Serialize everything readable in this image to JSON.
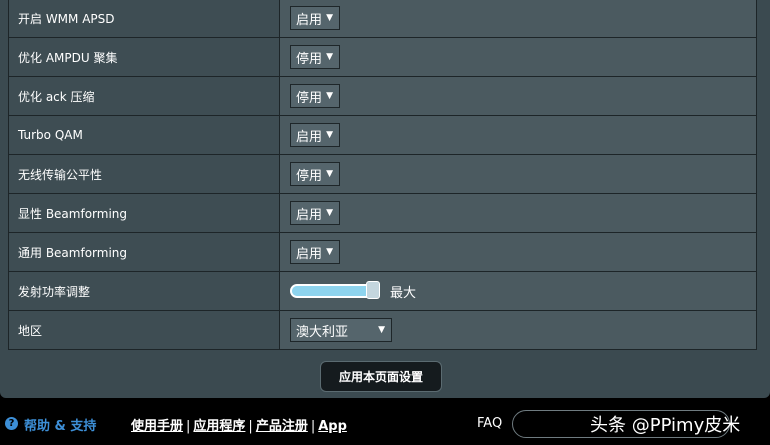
{
  "rows": [
    {
      "label": "开启 WMM APSD",
      "value": "启用"
    },
    {
      "label": "优化 AMPDU 聚集",
      "value": "停用"
    },
    {
      "label": "优化 ack 压缩",
      "value": "停用"
    },
    {
      "label": "Turbo QAM",
      "value": "启用"
    },
    {
      "label": "无线传输公平性",
      "value": "停用"
    },
    {
      "label": "显性 Beamforming",
      "value": "启用"
    },
    {
      "label": "通用 Beamforming",
      "value": "启用"
    },
    {
      "label": "发射功率调整",
      "value": "最大",
      "level": 1.0
    },
    {
      "label": "地区",
      "value": "澳大利亚"
    }
  ],
  "apply_button": "应用本页面设置",
  "footer": {
    "help": "帮助 & 支持",
    "links": [
      "使用手册",
      "应用程序",
      "产品注册",
      "App"
    ],
    "faq": "FAQ",
    "watermark": "头条 @PPimy皮米"
  }
}
